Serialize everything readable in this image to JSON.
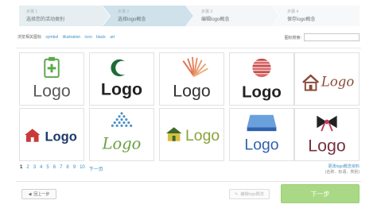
{
  "wizard": {
    "steps": [
      {
        "num": "步骤 1",
        "label": "选择您的活动类别"
      },
      {
        "num": "步骤 2",
        "label": "选择logo概念"
      },
      {
        "num": "步骤 3",
        "label": "编辑logo概念"
      },
      {
        "num": "步骤 4",
        "label": "保存logo概念"
      }
    ]
  },
  "filters": {
    "label": "浏览相关图标",
    "tags": [
      "symbol",
      "illustration",
      "icon",
      "black",
      "art"
    ]
  },
  "search": {
    "label": "图标搜索:",
    "value": ""
  },
  "tiles": [
    {
      "word": "Logo",
      "icon": "clipboard-plus-icon",
      "color": "#5aa84a"
    },
    {
      "word": "Logo",
      "icon": "crescent-moon-icon",
      "color": "#222222"
    },
    {
      "word": "Logo",
      "icon": "sunburst-fan-icon",
      "color": "#333333"
    },
    {
      "word": "Logo",
      "icon": "striped-globe-icon",
      "color": "#222222"
    },
    {
      "word": "Logo",
      "icon": "house-icon",
      "color": "#8a4a3a"
    },
    {
      "word": "Logo",
      "icon": "red-house-icon",
      "color": "#1b3a6b"
    },
    {
      "word": "Logo",
      "icon": "dot-triangle-icon",
      "color": "#6aa040"
    },
    {
      "word": "Logo",
      "icon": "green-house-icon",
      "color": "#8aa23a"
    },
    {
      "word": "Logo",
      "icon": "blue-rectangle-icon",
      "color": "#2f62b0"
    },
    {
      "word": "Logo",
      "icon": "bow-ribbon-icon",
      "color": "#7a3040"
    }
  ],
  "pagination": {
    "pages": [
      "1",
      "2",
      "3",
      "4",
      "5",
      "6",
      "7",
      "8",
      "9",
      "10"
    ],
    "current": "1",
    "next": "下一页"
  },
  "more": {
    "link": "更改logo概念资料",
    "note": "(名称、标语、类别)"
  },
  "buttons": {
    "back": "回上一步",
    "edit": "编辑logo概念",
    "next": "下一步"
  },
  "colors": {
    "accent": "#3d8ec4",
    "next_button": "#a9d984"
  }
}
